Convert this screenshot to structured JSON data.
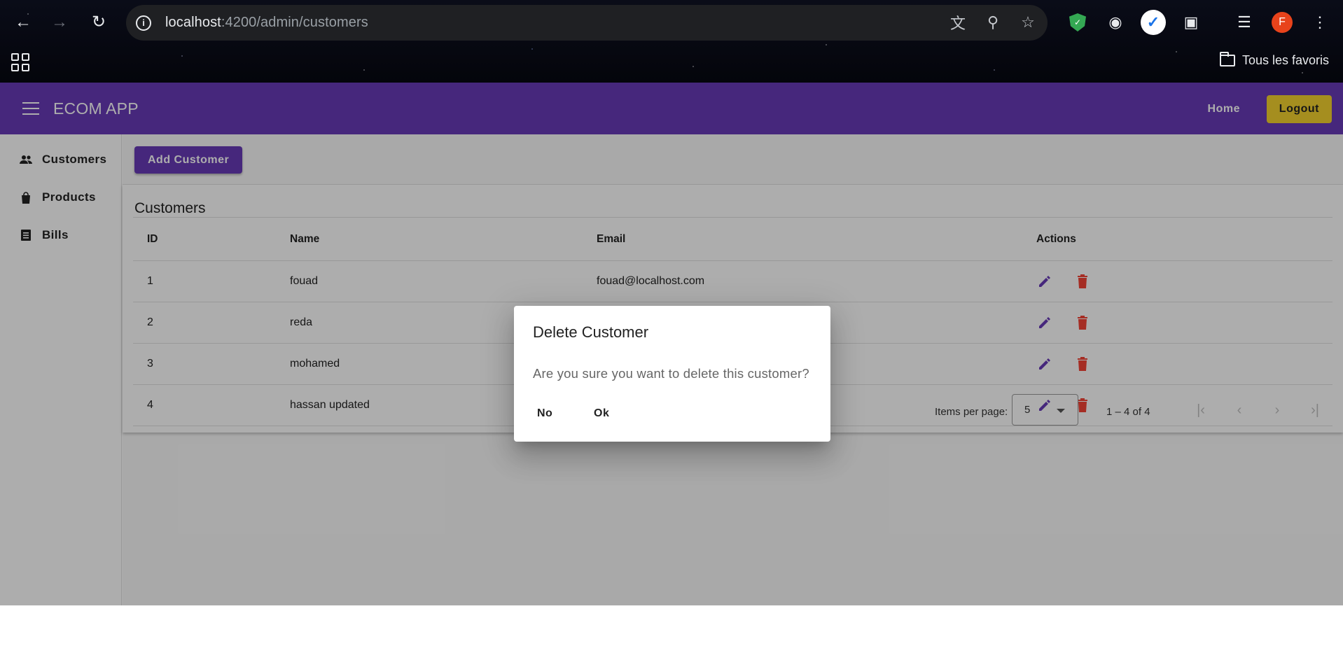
{
  "browser": {
    "url_host": "localhost",
    "url_path": ":4200/admin/customers",
    "bookmarks_label": "Tous les favoris",
    "avatar_letter": "F"
  },
  "toolbar": {
    "title": "ECOM APP",
    "home_label": "Home",
    "logout_label": "Logout"
  },
  "sidebar": {
    "items": [
      {
        "label": "Customers",
        "icon": "people-icon"
      },
      {
        "label": "Products",
        "icon": "shopping-bag-icon"
      },
      {
        "label": "Bills",
        "icon": "receipt-icon"
      }
    ]
  },
  "actions": {
    "add_label": "Add Customer"
  },
  "customers": {
    "title": "Customers",
    "columns": [
      "ID",
      "Name",
      "Email",
      "Actions"
    ],
    "rows": [
      {
        "id": "1",
        "name": "fouad",
        "email": "fouad@localhost.com"
      },
      {
        "id": "2",
        "name": "reda",
        "email": ""
      },
      {
        "id": "3",
        "name": "mohamed",
        "email": ""
      },
      {
        "id": "4",
        "name": "hassan updated",
        "email": ""
      }
    ]
  },
  "paginator": {
    "items_per_page_label": "Items per page:",
    "page_size": "5",
    "range_label": "1 – 4 of 4"
  },
  "dialog": {
    "title": "Delete Customer",
    "message": "Are you sure you want to delete this customer?",
    "no_label": "No",
    "ok_label": "Ok"
  },
  "colors": {
    "primary": "#673ab7",
    "accent": "#f3d22f",
    "warn": "#f44336"
  }
}
